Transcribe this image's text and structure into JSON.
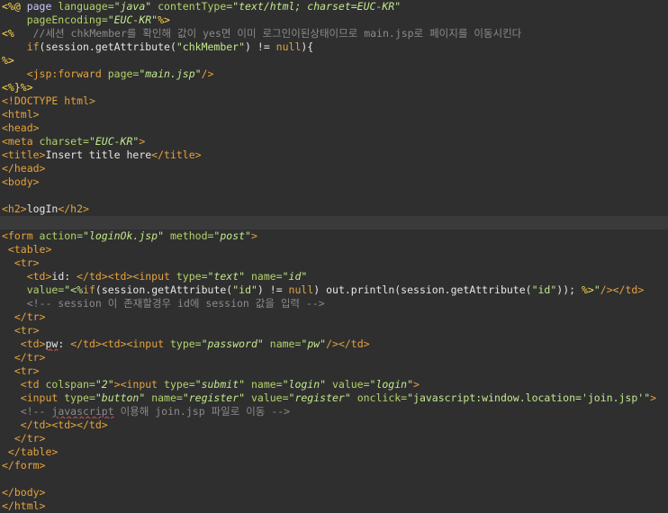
{
  "editor": {
    "lines": [
      {
        "tokens": [
          [
            "<%@ ",
            "jsp"
          ],
          [
            "page ",
            "kw"
          ],
          [
            "language=",
            "attr"
          ],
          [
            "\"java\"",
            "str"
          ],
          [
            " contentType=",
            "attr"
          ],
          [
            "\"text/html; charset=EUC-KR\"",
            "str"
          ]
        ]
      },
      {
        "tokens": [
          [
            "    pageEncoding=",
            "attr"
          ],
          [
            "\"EUC-KR\"",
            "str"
          ],
          [
            "%>",
            "jsp"
          ]
        ]
      },
      {
        "tokens": [
          [
            "<%",
            "jsp"
          ],
          [
            "   //세션 chkMember를 확인해 값이 yes면 이미 로그인이된상태이므로 main.jsp로 페이지를 이동시킨다",
            "com"
          ]
        ]
      },
      {
        "tokens": [
          [
            "    if",
            "null"
          ],
          [
            "(session.getAttribute(",
            "def"
          ],
          [
            "\"chkMember\"",
            "str2"
          ],
          [
            ") != ",
            "def"
          ],
          [
            "null",
            "null"
          ],
          [
            "){",
            "def"
          ]
        ]
      },
      {
        "tokens": [
          [
            "%>",
            "jsp"
          ]
        ]
      },
      {
        "tokens": [
          [
            "    <",
            "tag"
          ],
          [
            "jsp:forward ",
            "tag"
          ],
          [
            "page=",
            "attr"
          ],
          [
            "\"main.jsp\"",
            "str"
          ],
          [
            "/>",
            "tag"
          ]
        ]
      },
      {
        "tokens": [
          [
            "<%}%>",
            "jsp"
          ]
        ]
      },
      {
        "tokens": [
          [
            "<!DOCTYPE ",
            "tag"
          ],
          [
            "html",
            "tag"
          ],
          [
            ">",
            "tag"
          ]
        ]
      },
      {
        "tokens": [
          [
            "<html>",
            "tag"
          ]
        ]
      },
      {
        "tokens": [
          [
            "<head>",
            "tag"
          ]
        ]
      },
      {
        "tokens": [
          [
            "<meta ",
            "tag"
          ],
          [
            "charset=",
            "attr"
          ],
          [
            "\"EUC-KR\"",
            "str"
          ],
          [
            ">",
            "tag"
          ]
        ]
      },
      {
        "tokens": [
          [
            "<title>",
            "tag"
          ],
          [
            "Insert title here",
            "def"
          ],
          [
            "</title>",
            "tag"
          ]
        ]
      },
      {
        "tokens": [
          [
            "</head>",
            "tag"
          ]
        ]
      },
      {
        "tokens": [
          [
            "<body>",
            "tag"
          ]
        ]
      },
      {
        "tokens": []
      },
      {
        "tokens": [
          [
            "<h2>",
            "tag"
          ],
          [
            "logIn",
            "def"
          ],
          [
            "</h2>",
            "tag"
          ]
        ]
      },
      {
        "tokens": [],
        "current": true
      },
      {
        "tokens": [
          [
            "<form ",
            "tag"
          ],
          [
            "action=",
            "attr"
          ],
          [
            "\"loginOk.jsp\"",
            "str"
          ],
          [
            " method=",
            "attr"
          ],
          [
            "\"post\"",
            "str"
          ],
          [
            ">",
            "tag"
          ]
        ]
      },
      {
        "tokens": [
          [
            " <table>",
            "tag"
          ]
        ]
      },
      {
        "tokens": [
          [
            "  <tr>",
            "tag"
          ]
        ]
      },
      {
        "tokens": [
          [
            "    <td>",
            "tag"
          ],
          [
            "id: ",
            "def"
          ],
          [
            "</td><td><input ",
            "tag"
          ],
          [
            "type=",
            "attr"
          ],
          [
            "\"text\"",
            "str"
          ],
          [
            " name=",
            "attr"
          ],
          [
            "\"id\"",
            "str"
          ]
        ]
      },
      {
        "tokens": [
          [
            "    value=",
            "attr"
          ],
          [
            "\"<%",
            "str"
          ],
          [
            "if",
            "null"
          ],
          [
            "(session.getAttribute(",
            "def"
          ],
          [
            "\"id\"",
            "str2"
          ],
          [
            ") != ",
            "def"
          ],
          [
            "null",
            "null"
          ],
          [
            ") out.println(session.getAttribute(",
            "def"
          ],
          [
            "\"id\"",
            "str2"
          ],
          [
            "));",
            "def"
          ],
          [
            " %>",
            "jsp"
          ],
          [
            "\"",
            "str"
          ],
          [
            "/></td>",
            "tag"
          ]
        ]
      },
      {
        "tokens": [
          [
            "    <!-- session 이 존재할경우 id에 session 값을 입력 -->",
            "com"
          ]
        ]
      },
      {
        "tokens": [
          [
            "  </tr>",
            "tag"
          ]
        ]
      },
      {
        "tokens": [
          [
            "  <tr>",
            "tag"
          ]
        ]
      },
      {
        "tokens": [
          [
            "   <td>",
            "tag"
          ],
          [
            "pw",
            "def",
            "squig"
          ],
          [
            ": ",
            "def"
          ],
          [
            "</td><td><input ",
            "tag"
          ],
          [
            "type=",
            "attr"
          ],
          [
            "\"password\"",
            "str"
          ],
          [
            " name=",
            "attr"
          ],
          [
            "\"pw\"",
            "str"
          ],
          [
            "/></td>",
            "tag"
          ]
        ]
      },
      {
        "tokens": [
          [
            "  </tr>",
            "tag"
          ]
        ]
      },
      {
        "tokens": [
          [
            "  <tr>",
            "tag"
          ]
        ]
      },
      {
        "tokens": [
          [
            "   <td ",
            "tag"
          ],
          [
            "colspan=",
            "attr"
          ],
          [
            "\"2\"",
            "str"
          ],
          [
            "><input ",
            "tag"
          ],
          [
            "type=",
            "attr"
          ],
          [
            "\"submit\"",
            "str"
          ],
          [
            " name=",
            "attr"
          ],
          [
            "\"login\"",
            "str"
          ],
          [
            " value=",
            "attr"
          ],
          [
            "\"login\"",
            "str"
          ],
          [
            ">",
            "tag"
          ]
        ]
      },
      {
        "tokens": [
          [
            "   <input ",
            "tag"
          ],
          [
            "type=",
            "attr"
          ],
          [
            "\"button\"",
            "str"
          ],
          [
            " name=",
            "attr"
          ],
          [
            "\"register\"",
            "str"
          ],
          [
            " value=",
            "attr"
          ],
          [
            "\"register\"",
            "str"
          ],
          [
            " onclick=",
            "attr"
          ],
          [
            "\"javascript:window.location='join.jsp'\"",
            "str2"
          ],
          [
            ">",
            "tag"
          ]
        ]
      },
      {
        "tokens": [
          [
            "   <!-- ",
            "com"
          ],
          [
            "javascript",
            "com",
            "squig"
          ],
          [
            " 이용해 join.jsp 파일로 이동 -->",
            "com"
          ]
        ]
      },
      {
        "tokens": [
          [
            "   </td><td></td>",
            "tag"
          ]
        ]
      },
      {
        "tokens": [
          [
            "  </tr>",
            "tag"
          ]
        ]
      },
      {
        "tokens": [
          [
            " </table>",
            "tag"
          ]
        ]
      },
      {
        "tokens": [
          [
            "</form>",
            "tag"
          ]
        ]
      },
      {
        "tokens": []
      },
      {
        "tokens": [
          [
            "</body>",
            "tag"
          ]
        ]
      },
      {
        "tokens": [
          [
            "</html>",
            "tag"
          ]
        ]
      }
    ]
  }
}
